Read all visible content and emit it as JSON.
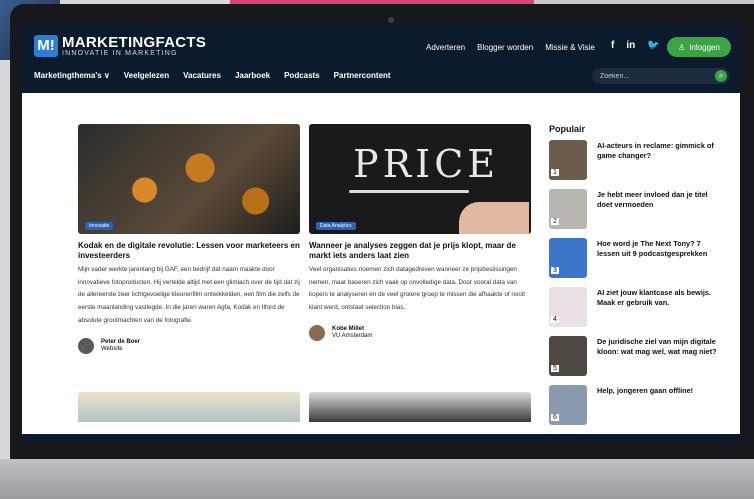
{
  "site": {
    "logo_mark": "M!",
    "logo_title": "MARKETINGFACTS",
    "logo_subtitle": "INNOVATIE IN MARKETING"
  },
  "header": {
    "top_links": [
      "Adverteren",
      "Blogger worden",
      "Missie & Visie"
    ],
    "social_icons": [
      {
        "name": "facebook-icon",
        "glyph": "f"
      },
      {
        "name": "linkedin-icon",
        "glyph": "in"
      },
      {
        "name": "twitter-icon",
        "glyph": "🐦"
      }
    ],
    "login_label": "Inloggen",
    "nav": [
      "Marketingthema's ∨",
      "Veelgelezen",
      "Vacatures",
      "Jaarboek",
      "Podcasts",
      "Partnercontent"
    ],
    "search_placeholder": "Zoeken..."
  },
  "articles": [
    {
      "tag": "Innovatie",
      "title": "Kodak en de digitale revolutie: Lessen voor marketeers en investeerders",
      "excerpt": "Mijn vader werkte jarenlang bij GAF, een bedrijf dat naam maakte door innovatieve fotoproducten. Hij vertelde altijd met een glimlach over de tijd dat zij de allereerste zeer lichtgevoelige kleurenfilm ontwikkelden, een film die zelfs de eerste maanlanding vastlegde. In die jaren waren Agfa, Kodak en Ilford de absolute grootmachten van de fotografie.",
      "author": "Peter de Boer",
      "author_org": "Website"
    },
    {
      "tag": "Data Analytics",
      "image_text": "PRICE",
      "title": "Wanneer je analyses zeggen dat je prijs klopt, maar de markt iets anders laat zien",
      "excerpt": "Veel organisaties noemen zich datagedreven wanneer ze prijsbeslissingen nemen, maar baseren zich vaak op onvolledige data. Door vooral data van kopers te analyseren en de veel grotere groep te missen die afhaakte of nooit klant werd, ontstaat selection bias.",
      "author": "Kobe Millet",
      "author_org": "VU Amsterdam"
    }
  ],
  "popular": {
    "title": "Populair",
    "items": [
      {
        "num": "1",
        "text": "AI-acteurs in reclame: gimmick of game changer?",
        "color": "#6a5b4a"
      },
      {
        "num": "2",
        "text": "Je hebt meer invloed dan je titel doet vermoeden",
        "color": "#b8b6b0"
      },
      {
        "num": "3",
        "text": "Hoe word je The Next Tony? 7 lessen uit 9 podcastgesprekken",
        "color": "#3c74c9"
      },
      {
        "num": "4",
        "text": "AI ziet jouw klantcase als bewijs. Maak er gebruik van.",
        "color": "#e8e0e6"
      },
      {
        "num": "5",
        "text": "De juridische ziel van mijn digitale kloon: wat mag wel, wat mag niet?",
        "color": "#4e4a42"
      },
      {
        "num": "6",
        "text": "Help, jongeren gaan offline!",
        "color": "#8a9bb0"
      }
    ]
  }
}
